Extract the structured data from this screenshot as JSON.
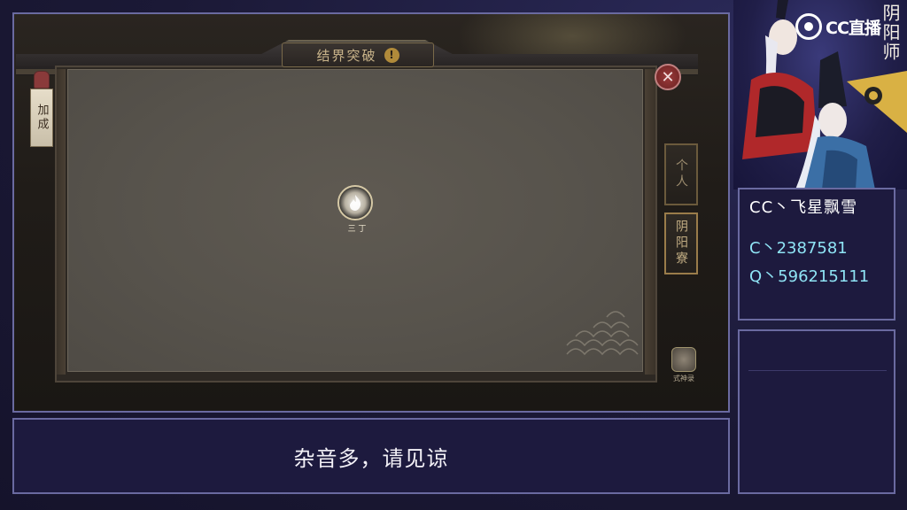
{
  "game": {
    "window_title": "结界突破",
    "info_symbol": "!",
    "close_symbol": "✕",
    "buff_tab_label": "加成",
    "side_tabs": [
      {
        "label": "个人"
      },
      {
        "label": "阴阳寮"
      }
    ],
    "marker_label": "三 丁",
    "shikigami_label": "式神录"
  },
  "caption": {
    "text": "杂音多，请见谅"
  },
  "branding": {
    "platform_logo": "CC直播",
    "game_logo": "阴阳师"
  },
  "streamer": {
    "name": "CC丶飞星飘雪",
    "cc_id": "C丶2387581",
    "qq_id": "Q丶596215111"
  },
  "colors": {
    "frame_border": "#6a6aa0",
    "panel_bg": "#1d1a3e",
    "id_text": "#8fe4f5"
  }
}
